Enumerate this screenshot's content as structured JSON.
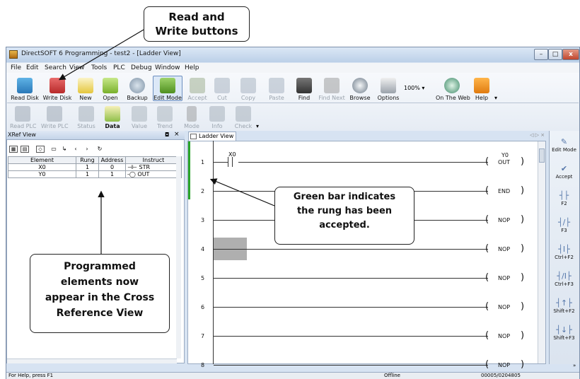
{
  "window": {
    "title": "DirectSOFT 6 Programming - test2 - [Ladder View]",
    "minimize": "–",
    "maximize": "□",
    "close": "x"
  },
  "menu": [
    "File",
    "Edit",
    "Search",
    "View",
    "Tools",
    "PLC",
    "Debug",
    "Window",
    "Help"
  ],
  "toolbar1": {
    "read_disk": "Read Disk",
    "write_disk": "Write Disk",
    "new": "New",
    "open": "Open",
    "backup": "Backup",
    "edit_mode": "Edit Mode",
    "accept": "Accept",
    "cut": "Cut",
    "copy": "Copy",
    "paste": "Paste",
    "find": "Find",
    "find_next": "Find Next",
    "browse": "Browse",
    "options": "Options",
    "zoom": "100%",
    "on_the_web": "On The Web",
    "help": "Help"
  },
  "toolbar2": {
    "read_plc": "Read PLC",
    "write_plc": "Write PLC",
    "status": "Status",
    "data": "Data",
    "value": "Value",
    "trend": "Trend",
    "mode": "Mode",
    "info": "Info",
    "check": "Check"
  },
  "xref": {
    "title": "XRef View",
    "columns": [
      "Element",
      "Rung",
      "Address",
      "Instruct"
    ],
    "rows": [
      {
        "element": "X0",
        "rung": "1",
        "address": "0",
        "instruction": "STR"
      },
      {
        "element": "Y0",
        "rung": "1",
        "address": "1",
        "instruction": "OUT"
      }
    ]
  },
  "ladder": {
    "tab": "Ladder View",
    "contact_label": "X0",
    "rungs": [
      {
        "num": "1",
        "coil": "OUT",
        "coil_label": "Y0"
      },
      {
        "num": "2",
        "coil": "END",
        "coil_label": ""
      },
      {
        "num": "3",
        "coil": "NOP",
        "coil_label": ""
      },
      {
        "num": "4",
        "coil": "NOP",
        "coil_label": ""
      },
      {
        "num": "5",
        "coil": "NOP",
        "coil_label": ""
      },
      {
        "num": "6",
        "coil": "NOP",
        "coil_label": ""
      },
      {
        "num": "7",
        "coil": "NOP",
        "coil_label": ""
      },
      {
        "num": "8",
        "coil": "NOP",
        "coil_label": ""
      }
    ]
  },
  "sidebar": [
    {
      "label": "Edit Mode",
      "glyph": "✎"
    },
    {
      "label": "Accept",
      "glyph": "✔"
    },
    {
      "label": "F2",
      "glyph": "┤├"
    },
    {
      "label": "F3",
      "glyph": "┤/├"
    },
    {
      "label": "Ctrl+F2",
      "glyph": "┤I├"
    },
    {
      "label": "Ctrl+F3",
      "glyph": "┤/I├"
    },
    {
      "label": "Shift+F2",
      "glyph": "┤↑├"
    },
    {
      "label": "Shift+F3",
      "glyph": "┤↓├"
    }
  ],
  "status": {
    "help": "For Help, press F1",
    "mode": "Offline",
    "address": "00005/02048",
    "col": "05"
  },
  "callouts": {
    "read_write": "Read and\nWrite buttons",
    "green_bar": "Green bar indicates\nthe rung has been\naccepted.",
    "programmed": "Programmed\nelements now\nappear in the Cross\nReference View"
  },
  "colors": {
    "accept_bar": "#2aa52a",
    "frame": "#d7e3f2"
  }
}
